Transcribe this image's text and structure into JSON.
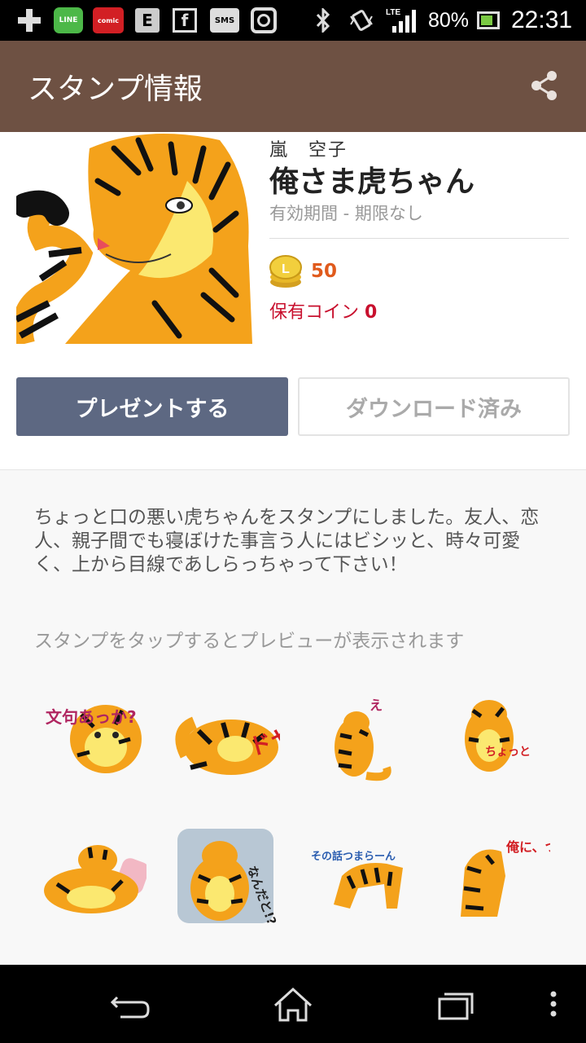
{
  "status_bar": {
    "time": "22:31",
    "battery": "80%",
    "network": "LTE",
    "icons": [
      "plus-icon",
      "line-app-icon",
      "comic-app-icon",
      "e-app-icon",
      "facebook-icon",
      "sms-icon",
      "instagram-icon",
      "bluetooth-icon",
      "vibrate-icon",
      "signal-icon",
      "battery-icon"
    ],
    "line_label": "LINE",
    "comic_label": "comic",
    "e_label": "E",
    "f_label": "f",
    "sms_label": "SMS"
  },
  "app_bar": {
    "title": "スタンプ情報",
    "share_icon": "share-icon"
  },
  "sticker": {
    "author": "嵐　空子",
    "name": "俺さま虎ちゃん",
    "validity": "有効期間 - 期限なし",
    "price": "50",
    "owned_label": "保有コイン",
    "owned_value": "0",
    "description": "ちょっと口の悪い虎ちゃんをスタンプにしました。友人、恋人、親子間でも寝ぼけた事言う人にはビシッと、時々可愛く、上から目線であしらっちゃって下さい！",
    "hint": "スタンプをタップするとプレビューが表示されます"
  },
  "buttons": {
    "present": "プレゼントする",
    "download": "ダウンロード済み"
  },
  "sticker_texts": [
    "文句あっか?",
    "ドヤ",
    "え",
    "ちょっと",
    "なんだと!?",
    "その話つまらーん",
    "俺に、ついてこい!!"
  ],
  "colors": {
    "app_bar": "#6e5143",
    "present_button": "#5d6882",
    "price": "#e05a1c",
    "owned": "#c8102e",
    "tiger_orange": "#f4a21b"
  }
}
